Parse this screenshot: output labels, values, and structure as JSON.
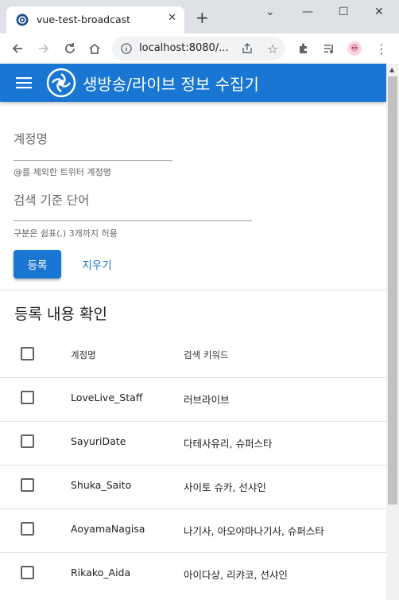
{
  "browser": {
    "tab_title": "vue-test-broadcast",
    "url": "localhost:8080/..."
  },
  "app": {
    "title": "생방송/라이브 정보 수집기"
  },
  "form": {
    "account_label": "계정명",
    "account_hint": "@를 제외한 트위터 계정명",
    "keyword_label": "검색 기준 단어",
    "keyword_hint": "구분은 쉼표(,) 3개까지 허용",
    "submit_label": "등록",
    "clear_label": "지우기"
  },
  "table": {
    "title": "등록 내용 확인",
    "headers": [
      "계정명",
      "검색 키워드"
    ],
    "rows": [
      {
        "account": "LoveLive_Staff",
        "keywords": "러브라이브"
      },
      {
        "account": "SayuriDate",
        "keywords": "다테사유리, 슈퍼스타"
      },
      {
        "account": "Shuka_Saito",
        "keywords": "사이토 슈카, 선샤인"
      },
      {
        "account": "AoyamaNagisa",
        "keywords": "나기사, 아오야마나기사, 슈퍼스타"
      },
      {
        "account": "Rikako_Aida",
        "keywords": "아이다상, 리캬코, 선샤인"
      }
    ]
  },
  "colors": {
    "primary": "#1976d2"
  }
}
